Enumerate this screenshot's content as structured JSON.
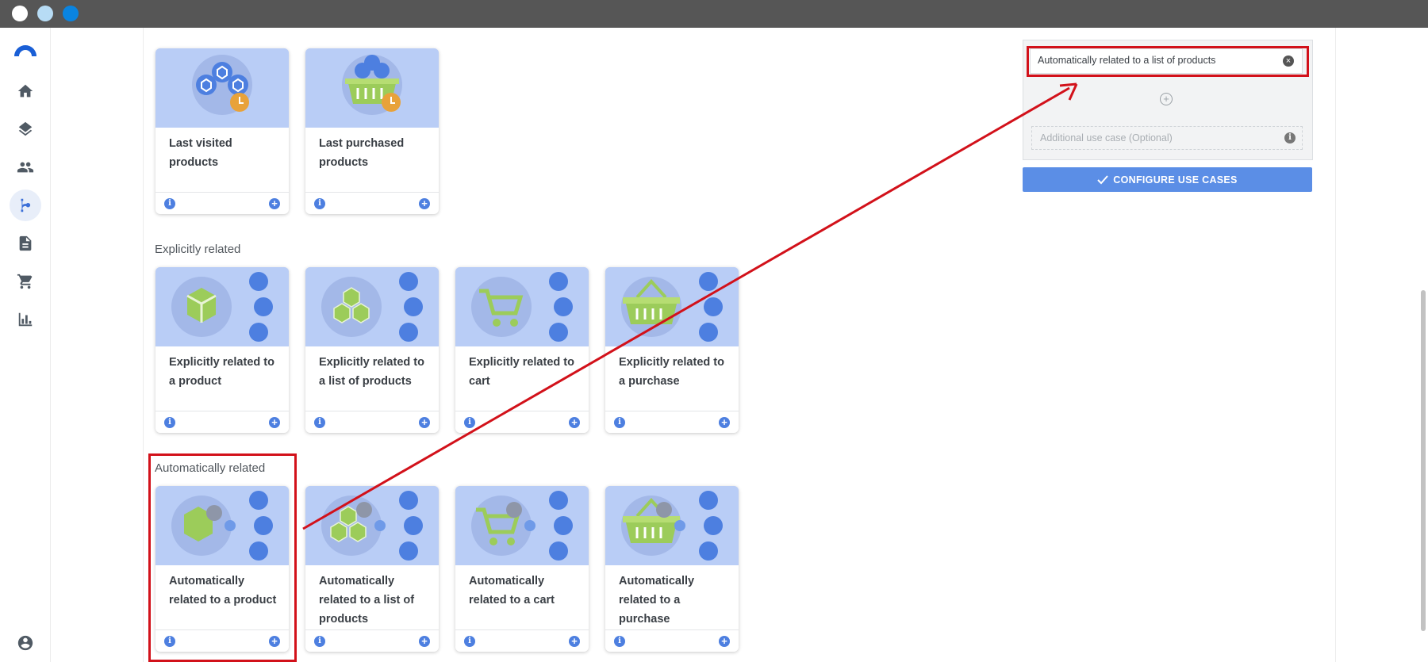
{
  "window": {
    "dots": [
      "#ffffff",
      "#b7dcf5",
      "#0a84e0"
    ]
  },
  "sidebar": {
    "items": [
      {
        "name": "home-icon"
      },
      {
        "name": "layers-icon"
      },
      {
        "name": "people-icon"
      },
      {
        "name": "flow-icon"
      },
      {
        "name": "document-icon"
      },
      {
        "name": "cart-icon"
      },
      {
        "name": "bar-chart-icon"
      }
    ],
    "account": {
      "name": "account-icon"
    }
  },
  "sections": [
    {
      "title": "",
      "cards": [
        {
          "label": "Last visited products"
        },
        {
          "label": "Last purchased products"
        }
      ]
    },
    {
      "title": "Explicitly related",
      "cards": [
        {
          "label": "Explicitly related to a product"
        },
        {
          "label": "Explicitly related to a list of products"
        },
        {
          "label": "Explicitly related to cart"
        },
        {
          "label": "Explicitly related to a purchase"
        }
      ]
    },
    {
      "title": "Automatically related",
      "cards": [
        {
          "label": "Automatically related to a product"
        },
        {
          "label": "Automatically related to a list of products"
        },
        {
          "label": "Automatically related to a cart"
        },
        {
          "label": "Automatically related to a purchase"
        }
      ]
    }
  ],
  "panel": {
    "selected_use_case": "Automatically related to a list of products",
    "optional_placeholder": "Additional use case (Optional)",
    "configure_label": "CONFIGURE USE CASES"
  },
  "colors": {
    "accent": "#5b8ee6",
    "highlight": "#d2111a",
    "thumb": "#b9cdf6"
  }
}
